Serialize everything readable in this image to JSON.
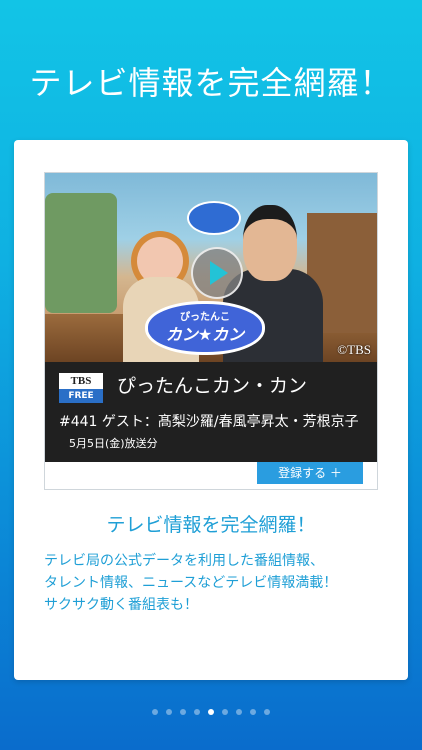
{
  "headline": "テレビ情報を完全網羅！",
  "card": {
    "video": {
      "channel_badge_top": "TBS",
      "channel_badge_bottom": "FREE",
      "show_logo_line1": "ぴったんこ",
      "show_logo_line2": "カン★カン",
      "copyright": "©TBS",
      "program_title": "ぴったんこカン・カン",
      "episode_text": "#441 ゲスト：髙梨沙羅/春風亭昇太・芳根京子",
      "air_date": "5月5日(金)放送分"
    },
    "register_label": "登録する ＋",
    "title": "テレビ情報を完全網羅！",
    "description_lines": [
      "テレビ局の公式データを利用した番組情報、",
      "タレント情報、ニュースなどテレビ情報満載！",
      "サクサク動く番組表も！"
    ]
  },
  "pagination": {
    "total": 9,
    "active_index": 4
  }
}
